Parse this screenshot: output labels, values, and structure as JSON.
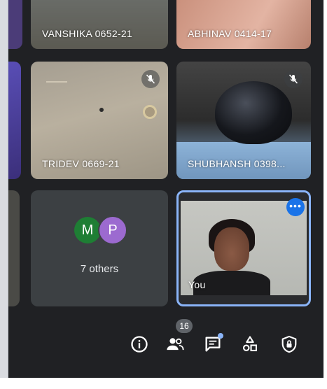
{
  "participants": [
    {
      "name": "VANSHIKA 0652-21",
      "muted": false
    },
    {
      "name": "ABHINAV 0414-17",
      "muted": false
    },
    {
      "name": "TRIDEV 0669-21",
      "muted": true
    },
    {
      "name": "SHUBHANSH 0398...",
      "muted": true
    }
  ],
  "others": {
    "avatars": [
      "M",
      "P"
    ],
    "label": "7 others"
  },
  "self": {
    "label": "You",
    "more_icon": "more-horiz-icon"
  },
  "toolbar": {
    "people_count": "16",
    "icons": [
      "info-icon",
      "people-icon",
      "chat-icon",
      "activities-icon",
      "host-controls-icon"
    ]
  },
  "colors": {
    "background": "#202124",
    "tile": "#3c4043",
    "self_border": "#8ab4f8",
    "accent": "#1a73e8"
  }
}
